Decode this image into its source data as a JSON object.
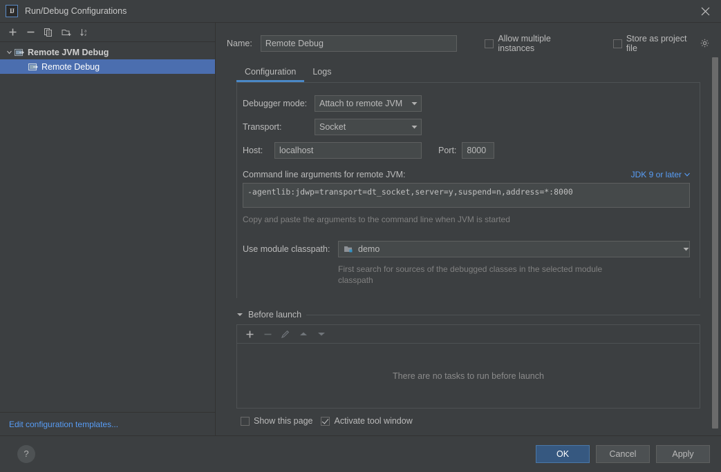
{
  "window": {
    "title": "Run/Debug Configurations",
    "app_icon": "IJ",
    "close_icon": "close-icon"
  },
  "sidebar": {
    "toolbar": [
      {
        "name": "add-configuration-button",
        "icon": "plus-icon",
        "enabled": true
      },
      {
        "name": "remove-configuration-button",
        "icon": "minus-icon",
        "enabled": true
      },
      {
        "name": "copy-configuration-button",
        "icon": "copy-icon",
        "enabled": true
      },
      {
        "name": "create-folder-button",
        "icon": "new-folder-icon",
        "enabled": true
      },
      {
        "name": "sort-configurations-button",
        "icon": "sort-alphabetically-icon",
        "enabled": true
      }
    ],
    "tree": [
      {
        "label": "Remote JVM Debug",
        "icon": "remote-debug-icon",
        "expanded": true,
        "selected": false,
        "level": 0
      },
      {
        "label": "Remote Debug",
        "icon": "remote-debug-icon",
        "expanded": false,
        "selected": true,
        "level": 1
      }
    ],
    "edit_templates_link": "Edit configuration templates..."
  },
  "form": {
    "name_label": "Name:",
    "name_value": "Remote Debug",
    "name_placeholder": "",
    "allow_multiple_instances": {
      "label": "Allow multiple instances",
      "checked": false
    },
    "store_as_project_file": {
      "label": "Store as project file",
      "checked": false,
      "gear_icon": "gear-icon"
    },
    "tabs": [
      {
        "label": "Configuration",
        "active": true
      },
      {
        "label": "Logs",
        "active": false
      }
    ],
    "debugger_mode": {
      "label": "Debugger mode:",
      "value": "Attach to remote JVM"
    },
    "transport": {
      "label": "Transport:",
      "value": "Socket"
    },
    "host": {
      "label": "Host:",
      "value": "localhost"
    },
    "port": {
      "label": "Port:",
      "value": "8000"
    },
    "command_line": {
      "label": "Command line arguments for remote JVM:",
      "jdk_selector": "JDK 9 or later",
      "value": "-agentlib:jdwp=transport=dt_socket,server=y,suspend=n,address=*:8000",
      "hint": "Copy and paste the arguments to the command line when JVM is started"
    },
    "module_classpath": {
      "label": "Use module classpath:",
      "value": "demo",
      "icon": "module-icon",
      "hint": "First search for sources of the debugged classes in the selected module classpath"
    }
  },
  "before_launch": {
    "title": "Before launch",
    "expanded": true,
    "toolbar": [
      {
        "name": "add-task-button",
        "icon": "plus-icon",
        "enabled": true
      },
      {
        "name": "remove-task-button",
        "icon": "minus-icon",
        "enabled": false
      },
      {
        "name": "edit-task-button",
        "icon": "pencil-icon",
        "enabled": false
      },
      {
        "name": "move-task-up-button",
        "icon": "arrow-up-icon",
        "enabled": false
      },
      {
        "name": "move-task-down-button",
        "icon": "arrow-down-icon",
        "enabled": false
      }
    ],
    "empty_text": "There are no tasks to run before launch",
    "show_this_page": {
      "label": "Show this page",
      "checked": false
    },
    "activate_tool_window": {
      "label": "Activate tool window",
      "checked": true
    }
  },
  "footer": {
    "help_label": "?",
    "ok_label": "OK",
    "cancel_label": "Cancel",
    "apply_label": "Apply"
  },
  "colors": {
    "background": "#3c3f41",
    "selection": "#4b6eaf",
    "accent": "#4a88c7",
    "link": "#589df6",
    "primary_button": "#365880",
    "input_background": "#45494a"
  }
}
